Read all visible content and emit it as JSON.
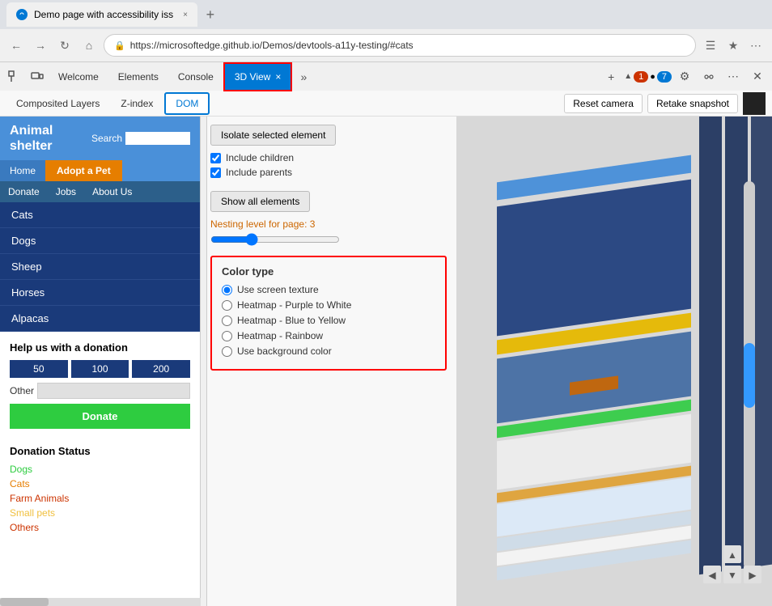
{
  "browser": {
    "tab_title": "Demo page with accessibility iss",
    "url": "https://microsoftedge.github.io/Demos/devtools-a11y-testing/#cats",
    "new_tab_label": "+",
    "close_tab": "×"
  },
  "devtools": {
    "tabs": [
      "Welcome",
      "Elements",
      "Console",
      "3D View",
      ""
    ],
    "active_tab": "3D View",
    "close_btn": "×",
    "sub_tabs": [
      "Composited Layers",
      "Z-index",
      "DOM"
    ],
    "active_sub_tab": "DOM",
    "reset_camera_label": "Reset camera",
    "retake_snapshot_label": "Retake snapshot",
    "badge_1": "1",
    "badge_7": "7"
  },
  "panel": {
    "isolate_btn": "Isolate selected element",
    "include_children": "Include children",
    "include_parents": "Include parents",
    "show_all_btn": "Show all elements",
    "nesting_label": "Nesting level for page: 3",
    "color_type_title": "Color type",
    "radio_options": [
      "Use screen texture",
      "Heatmap - Purple to White",
      "Heatmap - Blue to Yellow",
      "Heatmap - Rainbow",
      "Use background color"
    ],
    "selected_radio": 0
  },
  "website": {
    "title_line1": "Animal",
    "title_line2": "shelter",
    "search_label": "Search",
    "nav": {
      "home": "Home",
      "adopt": "Adopt a Pet",
      "donate": "Donate",
      "jobs": "Jobs",
      "about": "About Us"
    },
    "sidebar_items": [
      "Cats",
      "Dogs",
      "Sheep",
      "Horses",
      "Alpacas"
    ],
    "donation": {
      "title": "Help us with a donation",
      "amounts": [
        "50",
        "100",
        "200"
      ],
      "other_label": "Other",
      "donate_btn": "Donate"
    },
    "donation_status": {
      "title": "Donation Status",
      "items": [
        {
          "label": "Dogs",
          "color": "green"
        },
        {
          "label": "Cats",
          "color": "orange"
        },
        {
          "label": "Farm Animals",
          "color": "red"
        },
        {
          "label": "Small pets",
          "color": "yellow"
        },
        {
          "label": "Others",
          "color": "red"
        }
      ]
    }
  }
}
